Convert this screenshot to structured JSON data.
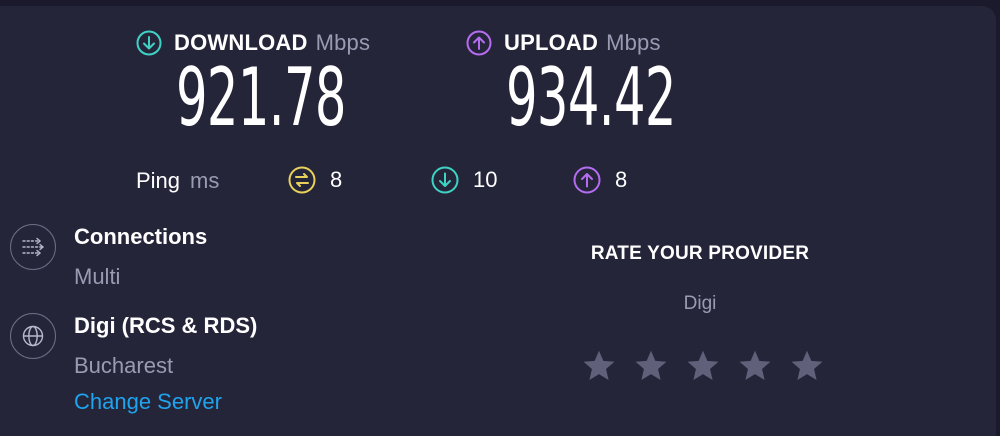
{
  "download": {
    "label": "DOWNLOAD",
    "unit": "Mbps",
    "value": "921.78",
    "color": "#3ed3c4"
  },
  "upload": {
    "label": "UPLOAD",
    "unit": "Mbps",
    "value": "934.42",
    "color": "#b56cf0"
  },
  "ping": {
    "label": "Ping",
    "unit": "ms",
    "idle": {
      "icon": "idle-ping-icon",
      "value": "8",
      "color": "#e8d25a"
    },
    "download": {
      "icon": "download-ping-icon",
      "value": "10",
      "color": "#3ed3c4"
    },
    "upload": {
      "icon": "upload-ping-icon",
      "value": "8",
      "color": "#b56cf0"
    }
  },
  "connections": {
    "icon": "connections-icon",
    "title": "Connections",
    "value": "Multi"
  },
  "server": {
    "icon": "globe-icon",
    "title": "Digi (RCS & RDS)",
    "location": "Bucharest",
    "change_label": "Change Server"
  },
  "rate": {
    "title": "RATE YOUR PROVIDER",
    "provider": "Digi",
    "stars_total": 5,
    "stars_selected": 0,
    "star_color": "#60607a"
  }
}
